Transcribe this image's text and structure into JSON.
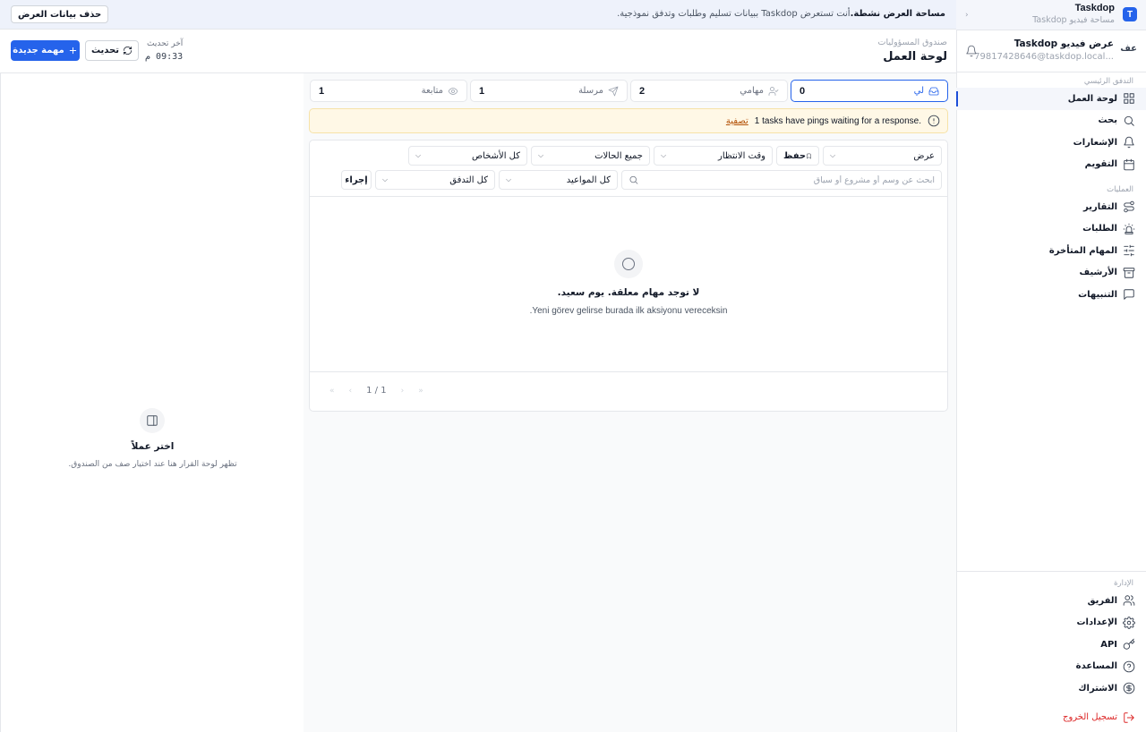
{
  "workspace": {
    "logo_letter": "T",
    "name": "Taskdop",
    "subtitle": "مساحة فيديو Taskdop",
    "chevron": "‹"
  },
  "user": {
    "avatar": "عف",
    "name": "عرض فيديو Taskdop",
    "email": "79817428646@taskdop.local..."
  },
  "nav": {
    "main_label": "التدفق الرئيسي",
    "main_items": [
      {
        "label": "لوحة العمل",
        "icon": "grid-icon"
      },
      {
        "label": "بحث",
        "icon": "search-icon"
      },
      {
        "label": "الإشعارات",
        "icon": "bell-icon"
      },
      {
        "label": "التقويم",
        "icon": "calendar-icon"
      }
    ],
    "ops_label": "العمليات",
    "ops_items": [
      {
        "label": "التقارير",
        "icon": "route-icon"
      },
      {
        "label": "الطلبات",
        "icon": "siren-icon"
      },
      {
        "label": "المهام المتأخرة",
        "icon": "sliders-icon"
      },
      {
        "label": "الأرشيف",
        "icon": "archive-icon"
      },
      {
        "label": "التنبيهات",
        "icon": "message-icon"
      }
    ],
    "admin_label": "الإدارة",
    "admin_items": [
      {
        "label": "الفريق",
        "icon": "users-icon"
      },
      {
        "label": "الإعدادات",
        "icon": "gear-icon"
      },
      {
        "label": "API",
        "icon": "key-icon"
      },
      {
        "label": "المساعدة",
        "icon": "help-icon"
      },
      {
        "label": "الاشتراك",
        "icon": "dollar-icon"
      }
    ],
    "logout": "تسجيل الخروج"
  },
  "banner": {
    "strong": "مساحة العرض نشطة.",
    "text": "أنت تستعرض Taskdop ببيانات تسليم وطلبات وتدفق نموذجية.",
    "button": "حذف بيانات العرض"
  },
  "header": {
    "breadcrumb": "صندوق المسؤوليات",
    "title": "لوحة العمل",
    "new_task": "مهمة جديدة",
    "refresh": "تحديث",
    "last_update_label": "آخر تحديث",
    "last_update_time": "09:33 م"
  },
  "tabs": [
    {
      "label": "لي",
      "count": "0",
      "icon": "inbox-icon"
    },
    {
      "label": "مهامي",
      "count": "2",
      "icon": "user-check-icon"
    },
    {
      "label": "مرسلة",
      "count": "1",
      "icon": "send-icon"
    },
    {
      "label": "متابعة",
      "count": "1",
      "icon": "eye-icon"
    }
  ],
  "alert": {
    "message": "1 tasks have pings waiting for a response.",
    "link": "تصفية"
  },
  "filters": {
    "view": "عرض",
    "save": "حفظ",
    "wait_time": "وقت الانتظار",
    "all_statuses": "جميع الحالات",
    "all_people": "كل الأشخاص",
    "search_placeholder": "ابحث عن وسم أو مشروع أو سياق",
    "all_dates": "كل المواعيد",
    "all_flow": "كل التدفق",
    "action": "إجراء"
  },
  "empty": {
    "title": "لا توجد مهام معلقة. يوم سعيد.",
    "subtitle": "Yeni görev gelirse burada ilk aksiyonu vereceksin."
  },
  "pager": {
    "first": "«",
    "prev": "‹",
    "page": "1 / 1",
    "next": "›",
    "last": "»"
  },
  "detail": {
    "title": "اختر عملاً",
    "subtitle": "تظهر لوحة القرار هنا عند اختيار صف من الصندوق."
  },
  "colors": {
    "accent": "#2563eb",
    "alert_bg": "#fff8e6",
    "alert_link": "#b45309",
    "logout": "#dc2626"
  }
}
